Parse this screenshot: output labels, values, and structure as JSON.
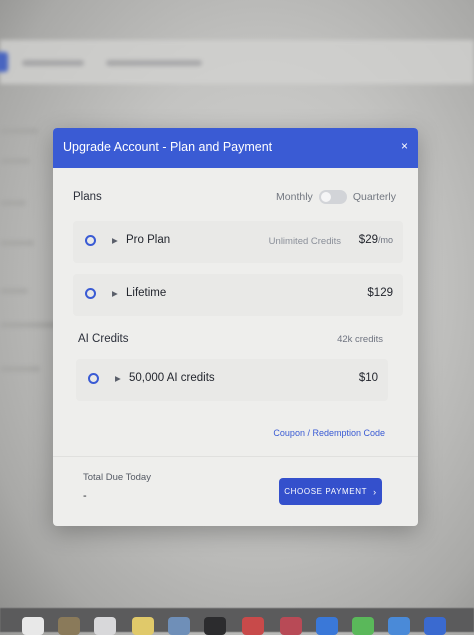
{
  "modal": {
    "title": "Upgrade Account - Plan and Payment",
    "close_glyph": "×"
  },
  "billing": {
    "section_label": "Plans",
    "monthly_label": "Monthly",
    "quarterly_label": "Quarterly"
  },
  "plans": [
    {
      "label": "Pro Plan",
      "sub": "Unlimited Credits",
      "price": "$29",
      "per": "/mo"
    },
    {
      "label": "Lifetime",
      "sub": "",
      "price": "$129",
      "per": ""
    }
  ],
  "ai_credits": {
    "section_label": "AI Credits",
    "count": "42k credits",
    "item": {
      "label": "50,000 AI credits",
      "price": "$10"
    }
  },
  "coupon_link": "Coupon / Redemption Code",
  "total": {
    "label": "Total Due Today",
    "value": "-"
  },
  "choose_button": {
    "label": "CHOOSE PAYMENT",
    "chevron": "›"
  },
  "colors": {
    "accent": "#3a5bd4",
    "header": "#3a5bd4",
    "modal_bg": "#eeeeec"
  },
  "icons": [
    "close-icon",
    "radio-icon",
    "caret-right-icon",
    "chevron-right-icon"
  ]
}
